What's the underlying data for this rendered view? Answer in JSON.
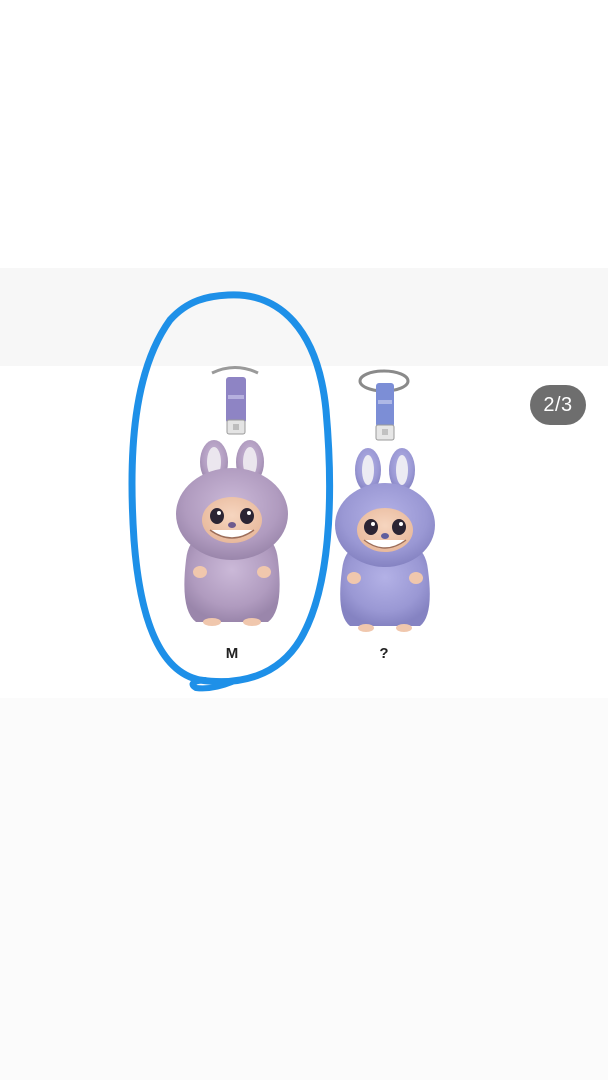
{
  "gallery": {
    "counter": "2/3",
    "items": [
      {
        "label": "M",
        "selected": true
      },
      {
        "label": "?",
        "selected": false
      }
    ]
  },
  "colors": {
    "highlight_circle": "#1e90e8",
    "counter_bg": "#6e6e6e",
    "plush_m": "#b8a5c8",
    "plush_q": "#9f9ed8"
  }
}
